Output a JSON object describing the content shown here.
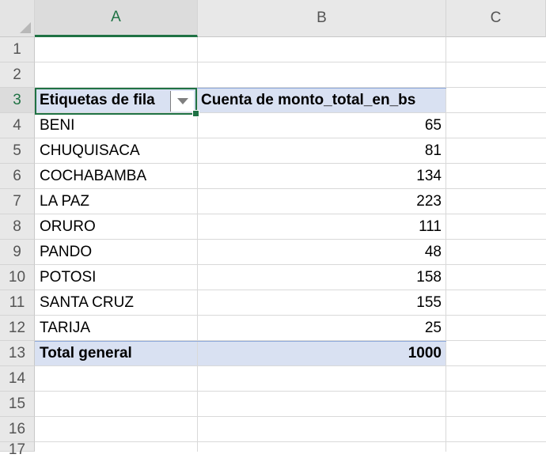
{
  "columns": [
    "A",
    "B",
    "C"
  ],
  "rows": [
    "1",
    "2",
    "3",
    "4",
    "5",
    "6",
    "7",
    "8",
    "9",
    "10",
    "11",
    "12",
    "13",
    "14",
    "15",
    "16",
    "17"
  ],
  "pivot": {
    "header_label": "Etiquetas de fila",
    "value_header": "Cuenta de monto_total_en_bs",
    "entries": [
      {
        "label": "BENI",
        "value": "65"
      },
      {
        "label": "CHUQUISACA",
        "value": "81"
      },
      {
        "label": "COCHABAMBA",
        "value": "134"
      },
      {
        "label": "LA PAZ",
        "value": "223"
      },
      {
        "label": "ORURO",
        "value": "111"
      },
      {
        "label": "PANDO",
        "value": "48"
      },
      {
        "label": "POTOSI",
        "value": "158"
      },
      {
        "label": "SANTA CRUZ",
        "value": "155"
      },
      {
        "label": "TARIJA",
        "value": "25"
      }
    ],
    "total_label": "Total general",
    "total_value": "1000"
  },
  "colors": {
    "accent": "#1f7244",
    "pivot_band": "#d9e1f2"
  },
  "icons": {
    "filter": "filter-dropdown-icon"
  }
}
